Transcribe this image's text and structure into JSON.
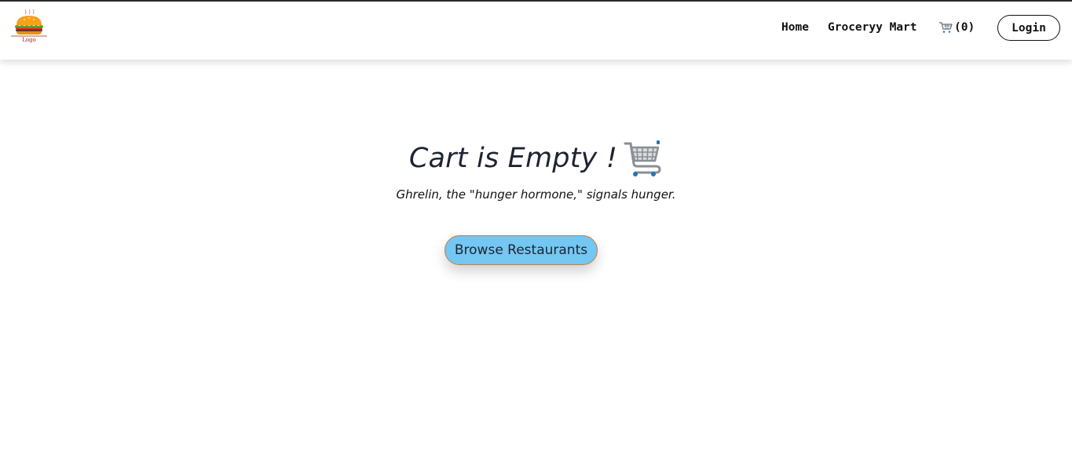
{
  "header": {
    "logo_icon": "burger-logo-icon",
    "logo_caption": "Logo",
    "nav": {
      "home_label": "Home",
      "grocery_label": "Groceryy Mart",
      "cart_icon": "shopping-cart-icon",
      "cart_count_label": "(0)",
      "login_label": "Login"
    }
  },
  "main": {
    "title": "Cart is Empty !",
    "title_icon": "shopping-cart-icon",
    "subtitle": "Ghrelin, the \"hunger hormone,\" signals hunger.",
    "browse_button_label": "Browse Restaurants"
  },
  "colors": {
    "browse_button_bg": "#74c7f2",
    "browse_button_border": "#c97b3d",
    "title_text": "#1e2433"
  }
}
